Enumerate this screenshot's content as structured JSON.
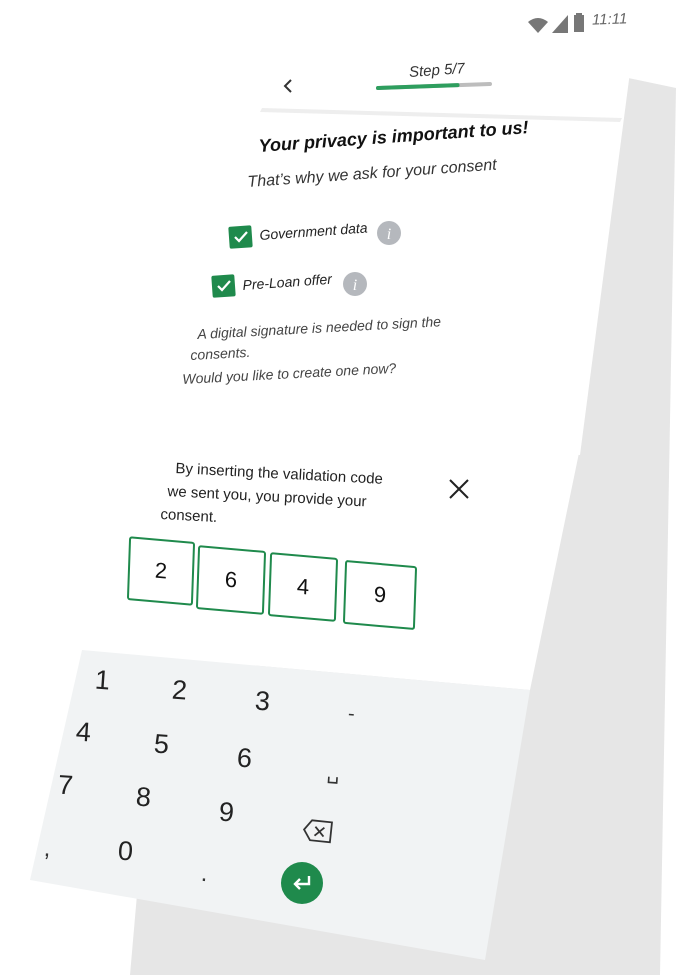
{
  "status_bar": {
    "time": "11:11"
  },
  "header": {
    "back_icon": "chevron-left-icon",
    "step_label": "Step 5/7",
    "progress_fraction": 0.71,
    "progress_color": "#2e9e5e",
    "track_color": "#bdbdbd"
  },
  "consent": {
    "title": "Your privacy is important to us!",
    "subtitle": "That’s why we ask for your consent",
    "items": [
      {
        "label": "Government data",
        "checked": true,
        "info_icon": "info-icon"
      },
      {
        "label": "Pre-Loan offer",
        "checked": true,
        "info_icon": "info-icon"
      }
    ],
    "signature_line1": "A digital signature is needed to sign the",
    "signature_line2": "consents.",
    "signature_line3": "Would you like to create one now?"
  },
  "sheet": {
    "text_line1": "By inserting the validation code",
    "text_line2": "we sent you, you provide your",
    "text_line3": "consent.",
    "close_icon": "close-icon",
    "code": [
      "2",
      "6",
      "4",
      "9"
    ],
    "accent_color": "#1f8a4c"
  },
  "keypad": {
    "keys": [
      "1",
      "2",
      "3",
      "-",
      "4",
      "5",
      "6",
      "␣",
      "7",
      "8",
      "9",
      "⌫",
      ",",
      "0",
      ".",
      "↵"
    ],
    "enter_color": "#1f8a4c"
  }
}
